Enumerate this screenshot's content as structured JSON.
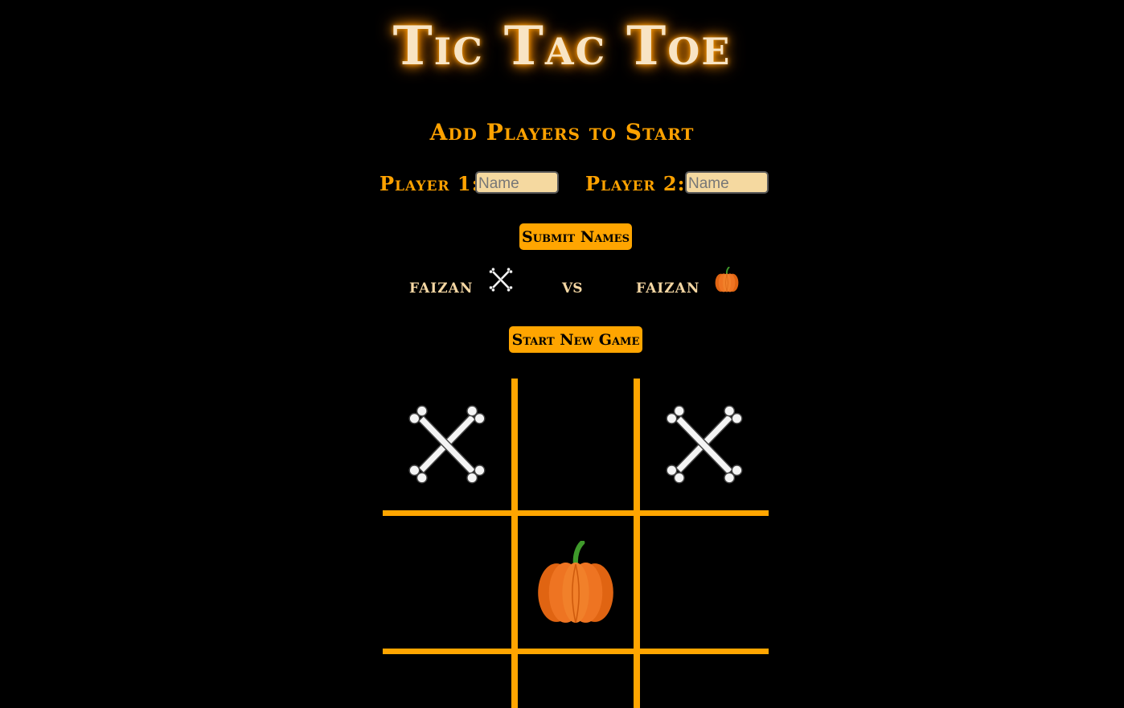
{
  "header": {
    "title": "Tic Tac Toe",
    "subtitle": "Add Players to Start"
  },
  "players_form": {
    "player1_label": "Player 1:",
    "player1_placeholder": "Name",
    "player2_label": "Player 2:",
    "player2_placeholder": "Name",
    "submit_label": "Submit Names"
  },
  "matchup": {
    "player1_name": "faizan",
    "player1_icon": "crossbones-icon",
    "vs_label": "vs",
    "player2_name": "faizan",
    "player2_icon": "pumpkin-icon"
  },
  "controls": {
    "new_game_label": "Start New Game"
  },
  "board": {
    "cells": [
      "crossbones",
      "",
      "crossbones",
      "",
      "pumpkin",
      "",
      "",
      "",
      ""
    ]
  },
  "colors": {
    "background": "#000000",
    "accent": "#ffa500",
    "title_text": "#f8e4c4",
    "name_text": "#f5d7a3"
  }
}
